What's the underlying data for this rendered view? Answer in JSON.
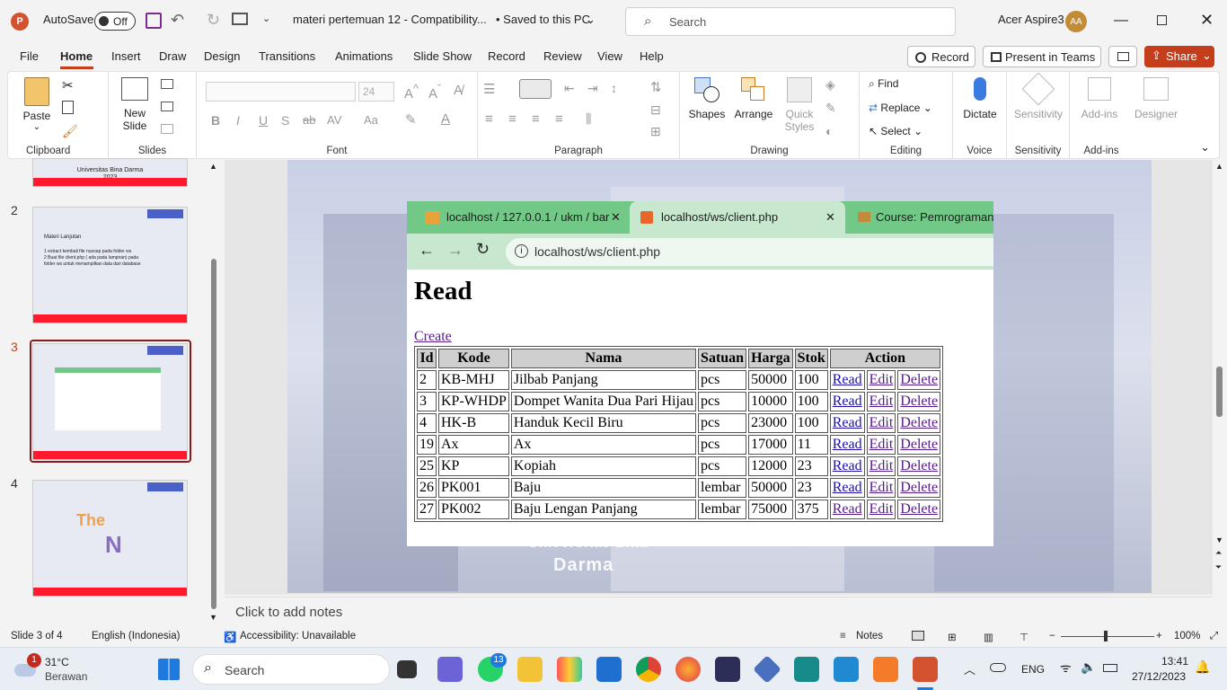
{
  "titlebar": {
    "autosave": "AutoSave",
    "autosave_state": "Off",
    "doc_title": "materi pertemuan 12  -  Compatibility...",
    "save_status": "•  Saved to this PC",
    "search_placeholder": "Search",
    "user_name": "Acer Aspire3",
    "user_initials": "AA"
  },
  "tabs": [
    "File",
    "Home",
    "Insert",
    "Draw",
    "Design",
    "Transitions",
    "Animations",
    "Slide Show",
    "Record",
    "Review",
    "View",
    "Help"
  ],
  "active_tab": "Home",
  "right_buttons": {
    "record": "Record",
    "present": "Present in Teams",
    "share": "Share"
  },
  "ribbon": {
    "clipboard": {
      "label": "Clipboard",
      "paste": "Paste"
    },
    "slides": {
      "label": "Slides",
      "new_slide": "New",
      "new_slide2": "Slide"
    },
    "font": {
      "label": "Font",
      "size": "24"
    },
    "paragraph": {
      "label": "Paragraph"
    },
    "drawing": {
      "label": "Drawing",
      "shapes": "Shapes",
      "arrange": "Arrange",
      "quick_styles": "Quick",
      "quick_styles2": "Styles"
    },
    "editing": {
      "label": "Editing",
      "find": "Find",
      "replace": "Replace",
      "select": "Select"
    },
    "voice": {
      "label": "Voice",
      "dictate": "Dictate"
    },
    "sensitivity": {
      "label": "Sensitivity",
      "btn": "Sensitivity"
    },
    "addins": {
      "label": "Add-ins",
      "btn": "Add-ins",
      "designer": "Designer"
    }
  },
  "thumbnails": [
    {
      "num": "2",
      "text1": "Materi Lanjutan",
      "text2": "1   extract kembali file nusoap pada folder ws",
      "text3": "2   Buat file client.php ( ada pada lampiran) pada",
      "text4": "    folder ws untuk menampilkan data dari database"
    },
    {
      "num": "3"
    },
    {
      "num": "4",
      "word1": "The",
      "word2": "N"
    }
  ],
  "thumb_top_text": {
    "line1": "Universitas Bina Darma",
    "line2": "2023"
  },
  "browser": {
    "tabs": [
      "localhost / 127.0.0.1 / ukm / bar",
      "localhost/ws/client.php",
      "Course: Pemrograman W"
    ],
    "url": "localhost/ws/client.php"
  },
  "page": {
    "heading": "Read",
    "create_link": "Create",
    "columns": [
      "Id",
      "Kode",
      "Nama",
      "Satuan",
      "Harga",
      "Stok",
      "Action"
    ],
    "actions": [
      "Read",
      "Edit",
      "Delete"
    ],
    "rows": [
      [
        "2",
        "KB-MHJ",
        "Jilbab Panjang",
        "pcs",
        "50000",
        "100"
      ],
      [
        "3",
        "KP-WHDP",
        "Dompet Wanita Dua Pari Hijau",
        "pcs",
        "10000",
        "100"
      ],
      [
        "4",
        "HK-B",
        "Handuk Kecil Biru",
        "pcs",
        "23000",
        "100"
      ],
      [
        "19",
        "Ax",
        "Ax",
        "pcs",
        "17000",
        "11"
      ],
      [
        "25",
        "KP",
        "Kopiah",
        "pcs",
        "12000",
        "23"
      ],
      [
        "26",
        "PK001",
        "Baju",
        "lembar",
        "50000",
        "23"
      ],
      [
        "27",
        "PK002",
        "Baju Lengan Panjang",
        "lembar",
        "75000",
        "375"
      ]
    ]
  },
  "slide_watermark": {
    "line1": "Universitas Bina",
    "line2": "Darma"
  },
  "notes_placeholder": "Click to add notes",
  "status": {
    "slide": "Slide 3 of 4",
    "language": "English (Indonesia)",
    "accessibility": "Accessibility: Unavailable",
    "notes": "Notes",
    "zoom": "100%"
  },
  "taskbar": {
    "temp": "31°C",
    "weather": "Berawan",
    "weather_badge": "1",
    "search": "Search",
    "whatsapp_badge": "13",
    "lang": "ENG",
    "time": "13:41",
    "date": "27/12/2023"
  }
}
